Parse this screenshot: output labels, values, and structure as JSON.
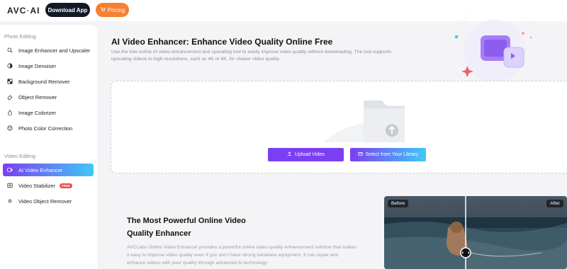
{
  "header": {
    "logo_text": "AVC",
    "logo_dot": "·",
    "logo_ai": "AI",
    "download_label": "Download App",
    "pricing_label": "Pricing"
  },
  "sidebar": {
    "photo_section": "Photo Editing",
    "photo_items": [
      {
        "label": "Image Enhancer and Upscaler",
        "icon": "zoom-icon"
      },
      {
        "label": "Image Denoiser",
        "icon": "denoise-icon"
      },
      {
        "label": "Background Remover",
        "icon": "background-icon"
      },
      {
        "label": "Object Remover",
        "icon": "eraser-icon"
      },
      {
        "label": "Image Colorizer",
        "icon": "colorize-icon"
      },
      {
        "label": "Photo Color Correction",
        "icon": "palette-icon"
      }
    ],
    "video_section": "Video Editing",
    "video_items": [
      {
        "label": "AI Video Enhancer",
        "icon": "video-enhance-icon",
        "active": true
      },
      {
        "label": "Video Stabilizer",
        "icon": "stabilizer-icon",
        "badge": "FREE"
      },
      {
        "label": "Video Object Remover",
        "icon": "video-eraser-icon"
      }
    ]
  },
  "hero": {
    "title": "AI Video Enhancer: Enhance Video Quality Online Free",
    "description": "Use the free online AI video enhancement and upscaling tool to easily improve video quality without downloading. The tool supports upscaling videos to high resolutions, such as 4K or 8K, for clearer video quality."
  },
  "upload": {
    "upload_label": "Upload Video",
    "library_label": "Select from Your Library"
  },
  "section2": {
    "title": "The Most Powerful Online Video Quality Enhancer",
    "description": "AVCLabs Online Video Enhancer provides a powerful online video quality enhancement solution that makes it easy to improve video quality even if you don't have strong hardware equipment. It can repair and enhance videos with poor quality through advanced AI technology."
  },
  "compare": {
    "before_label": "Before",
    "after_label": "After"
  },
  "colors": {
    "accent_purple": "#7b3ff2",
    "accent_cyan": "#3fc8f5",
    "pricing_orange": "#f77f2f",
    "download_dark": "#111827"
  }
}
